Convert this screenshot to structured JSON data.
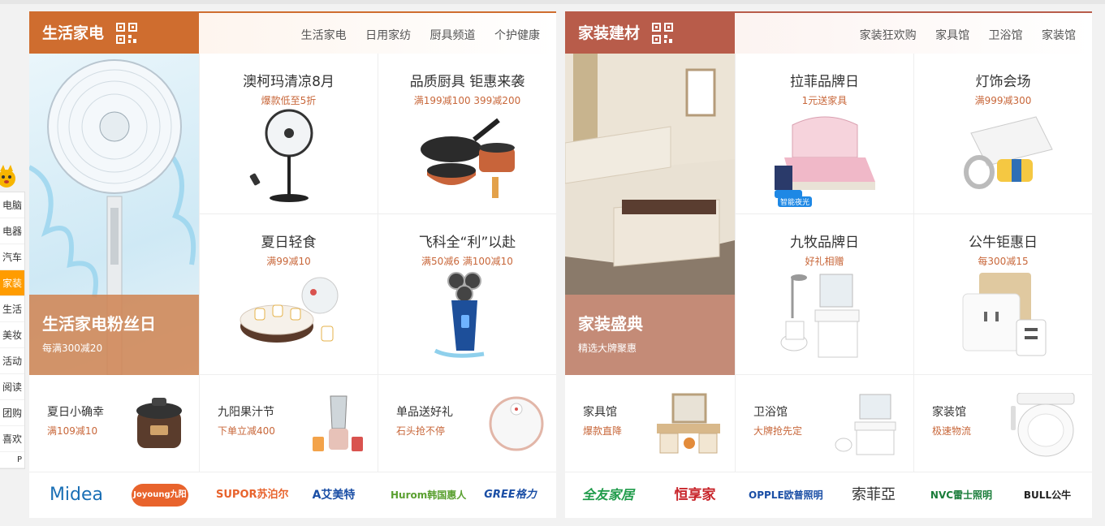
{
  "sidenav": {
    "items": [
      "电脑",
      "电器",
      "汽车",
      "家装",
      "生活",
      "美妆",
      "活动",
      "阅读",
      "团购",
      "喜欢",
      "P"
    ],
    "active_index": 3
  },
  "panel1": {
    "color": "#cf6d2f",
    "tab": "生活家电",
    "links": [
      "生活家电",
      "日用家纺",
      "厨具频道",
      "个护健康"
    ],
    "hero": {
      "title": "生活家电粉丝日",
      "sub": "每满300减20"
    },
    "cells": [
      {
        "title": "澳柯玛清凉8月",
        "sub": "爆款低至5折",
        "icon": "standing-fan-icon"
      },
      {
        "title": "品质厨具 钜惠来袭",
        "sub": "满199减100 399减200",
        "icon": "cookware-icon"
      },
      {
        "title": "夏日轻食",
        "sub": "满99减10",
        "icon": "yogurt-maker-icon"
      },
      {
        "title": "飞科全“利”以赴",
        "sub": "满50减6 满100减10",
        "icon": "shaver-icon"
      }
    ],
    "bottom": [
      {
        "title": "夏日小确幸",
        "sub": "满109减10",
        "icon": "pressure-cooker-icon"
      },
      {
        "title": "九阳果汁节",
        "sub": "下单立减400",
        "icon": "blender-icon"
      },
      {
        "title": "单品送好礼",
        "sub": "石头抢不停",
        "icon": "robot-vacuum-icon"
      }
    ],
    "brands": [
      "Midea",
      "Joyoung九阳",
      "SUPOR苏泊尔",
      "A艾美特",
      "Hurom韩国惠人",
      "GREE格力"
    ]
  },
  "panel2": {
    "color": "#b85c4a",
    "tab": "家装建材",
    "links": [
      "家装狂欢购",
      "家具馆",
      "卫浴馆",
      "家装馆"
    ],
    "hero": {
      "title": "家装盛典",
      "sub": "精选大牌聚惠"
    },
    "cells": [
      {
        "title": "拉菲品牌日",
        "sub": "1元送家具",
        "icon": "bed-icon",
        "badge": "智能夜光"
      },
      {
        "title": "灯饰会场",
        "sub": "满999减300",
        "icon": "ceiling-light-icon"
      },
      {
        "title": "九牧品牌日",
        "sub": "好礼相赠",
        "icon": "bathroom-set-icon"
      },
      {
        "title": "公牛钜惠日",
        "sub": "每300减15",
        "icon": "power-socket-icon"
      }
    ],
    "bottom": [
      {
        "title": "家具馆",
        "sub": "爆款直降",
        "icon": "dressing-table-icon"
      },
      {
        "title": "卫浴馆",
        "sub": "大牌抢先定",
        "icon": "bathroom-cabinet-icon"
      },
      {
        "title": "家装馆",
        "sub": "极速物流",
        "icon": "smart-toilet-seat-icon"
      }
    ],
    "brands": [
      "全友家居",
      "恒享家",
      "OPPLE欧普照明",
      "索菲亞",
      "NVC雷士照明",
      "BULL公牛"
    ]
  },
  "colors": {
    "sub_text": "#c8673a",
    "active_nav": "#ff9c00"
  }
}
